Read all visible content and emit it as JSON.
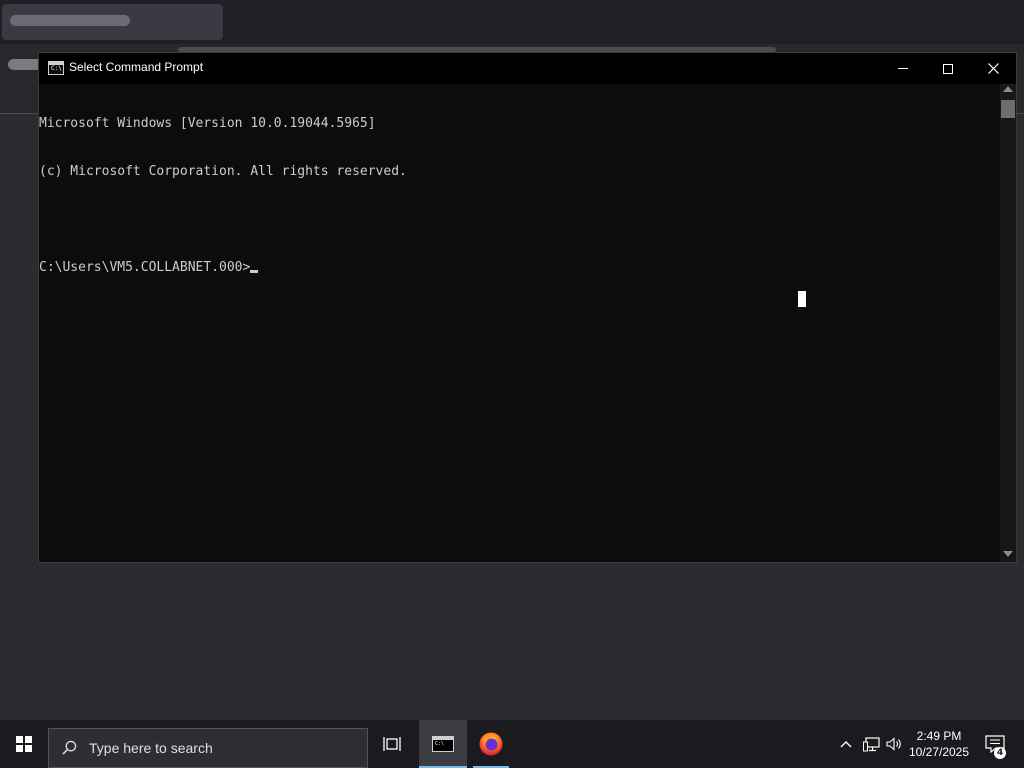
{
  "window": {
    "title": "Select Command Prompt",
    "icon": "cmd-icon",
    "icon_glyph": "C:\\",
    "controls": {
      "minimize": "minimize-icon",
      "maximize": "maximize-icon",
      "close": "close-icon"
    }
  },
  "console": {
    "lines": [
      "Microsoft Windows [Version 10.0.19044.5965]",
      "(c) Microsoft Corporation. All rights reserved.",
      "",
      "C:\\Users\\VM5.COLLABNET.000>"
    ]
  },
  "taskbar": {
    "search_placeholder": "Type here to search",
    "apps": [
      {
        "name": "Command Prompt",
        "icon": "cmd-icon",
        "active": true
      },
      {
        "name": "Firefox",
        "icon": "firefox-icon",
        "active": false
      }
    ],
    "clock": {
      "time": "2:49 PM",
      "date": "10/27/2025"
    },
    "notification_count": "4"
  },
  "colors": {
    "console_bg": "#0c0c0c",
    "console_fg": "#cccccc",
    "taskbar_bg": "#1b1b1f",
    "accent": "#76b9ed"
  }
}
